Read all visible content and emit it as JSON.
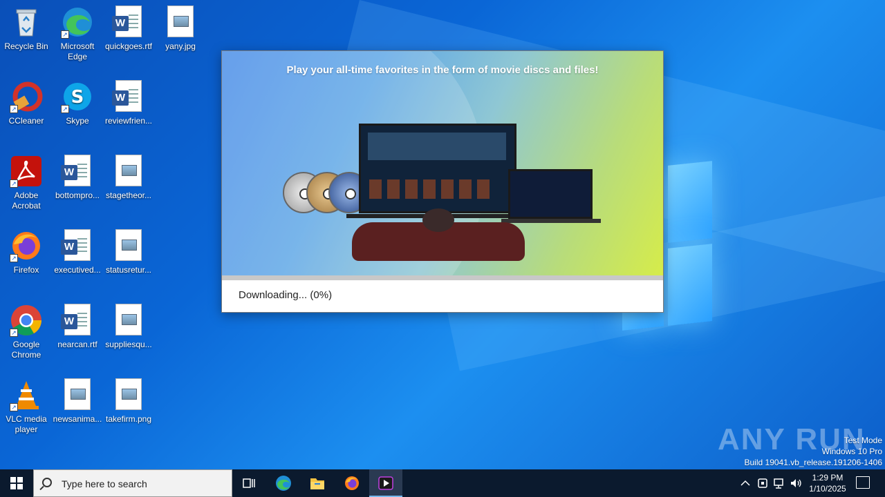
{
  "desktop": {
    "icons": [
      {
        "label": "Recycle Bin",
        "icon": "recycle-bin-icon"
      },
      {
        "label": "Microsoft Edge",
        "icon": "edge-icon"
      },
      {
        "label": "quickgoes.rtf",
        "icon": "word-doc-icon"
      },
      {
        "label": "yany.jpg",
        "icon": "image-file-icon"
      },
      {
        "label": "CCleaner",
        "icon": "ccleaner-icon"
      },
      {
        "label": "Skype",
        "icon": "skype-icon"
      },
      {
        "label": "reviewfrien...",
        "icon": "word-doc-icon"
      },
      {
        "label": "Adobe Acrobat",
        "icon": "acrobat-icon"
      },
      {
        "label": "bottompro...",
        "icon": "word-doc-icon"
      },
      {
        "label": "stagetheor...",
        "icon": "image-file-icon"
      },
      {
        "label": "Firefox",
        "icon": "firefox-icon"
      },
      {
        "label": "executived...",
        "icon": "word-doc-icon"
      },
      {
        "label": "statusretur...",
        "icon": "image-file-icon"
      },
      {
        "label": "Google Chrome",
        "icon": "chrome-icon"
      },
      {
        "label": "nearcan.rtf",
        "icon": "word-doc-icon"
      },
      {
        "label": "suppliesqu...",
        "icon": "image-file-icon"
      },
      {
        "label": "VLC media player",
        "icon": "vlc-icon"
      },
      {
        "label": "newsanima...",
        "icon": "image-file-icon"
      },
      {
        "label": "takefirm.png",
        "icon": "image-file-icon"
      }
    ]
  },
  "installer": {
    "banner_title": "Play your all-time favorites in the form of movie discs and files!",
    "progress_percent": 0,
    "status_text": "Downloading... (0%)"
  },
  "watermark": {
    "brand": "ANY RUN",
    "line1": "Test Mode",
    "line2": "Windows 10 Pro",
    "line3": "Build 19041.vb_release.191206-1406"
  },
  "taskbar": {
    "search_placeholder": "Type here to search",
    "pinned": [
      "task-view-icon",
      "edge-icon",
      "file-explorer-icon",
      "firefox-icon",
      "media-player-icon"
    ],
    "clock_time": "1:29 PM",
    "clock_date": "1/10/2025"
  },
  "colors": {
    "accent": "#2a7fd8",
    "taskbar": "#0b1a2e",
    "word": "#2b579a"
  }
}
